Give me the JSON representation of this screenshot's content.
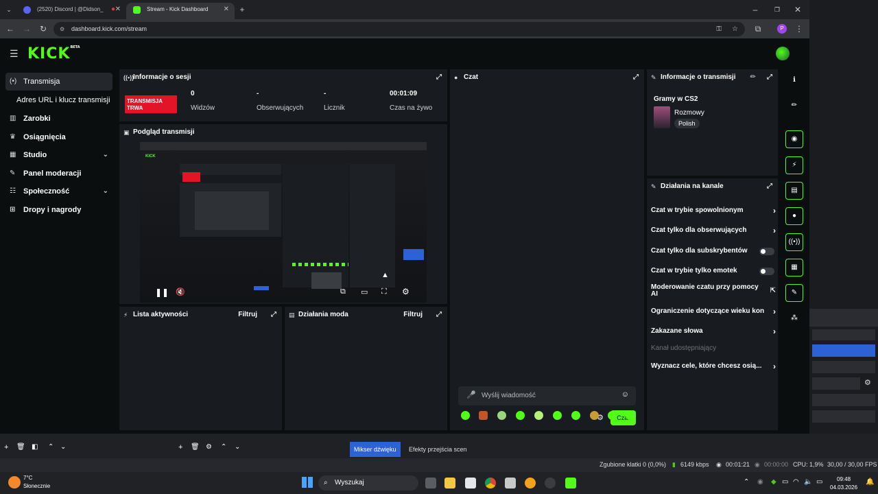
{
  "browser": {
    "tabs": [
      {
        "title": "(2520) Discord | @Didson_",
        "active": false
      },
      {
        "title": "Stream - Kick Dashboard",
        "active": true
      }
    ],
    "url": "dashboard.kick.com/stream",
    "profile_letter": "P"
  },
  "logo": {
    "text": "KICK",
    "badge": "BETA"
  },
  "sidebar": {
    "items": [
      {
        "label": "Transmisja",
        "active": true
      },
      {
        "label": "Zarobki"
      },
      {
        "label": "Osiągnięcia"
      },
      {
        "label": "Studio"
      },
      {
        "label": "Panel moderacji"
      },
      {
        "label": "Społeczność"
      },
      {
        "label": "Dropy i nagrody"
      }
    ],
    "subitem": "Adres URL i klucz transmisji"
  },
  "session": {
    "title": "Informacje o sesji",
    "live_badge": "TRANSMISJA TRWA",
    "stats": [
      {
        "value": "0",
        "label": "Widzów"
      },
      {
        "value": "-",
        "label": "Obserwujących"
      },
      {
        "value": "-",
        "label": "Licznik"
      },
      {
        "value": "00:01:09",
        "label": "Czas na żywo"
      }
    ]
  },
  "preview": {
    "title": "Podgląd transmisji"
  },
  "activity": {
    "title": "Lista aktywności",
    "filter": "Filtruj"
  },
  "modactions": {
    "title": "Działania moda",
    "filter": "Filtruj"
  },
  "chat": {
    "title": "Czat",
    "placeholder": "Wyślij wiadomość",
    "send": "Czat"
  },
  "streaminfo": {
    "title": "Informacje o transmisji",
    "stream_title": "Gramy w CS2",
    "category": "Rozmowy",
    "language": "Polish"
  },
  "channel": {
    "title": "Działania na kanale",
    "rows": [
      {
        "label": "Czat w trybie spowolnionym",
        "kind": "arrow"
      },
      {
        "label": "Czat tylko dla obserwujących",
        "kind": "arrow"
      },
      {
        "label": "Czat tylko dla subskrybentów",
        "kind": "toggle"
      },
      {
        "label": "Czat w trybie tylko emotek",
        "kind": "toggle"
      },
      {
        "label": "Moderowanie czatu przy pomocy AI",
        "kind": "ext"
      },
      {
        "label": "Ograniczenie dotyczące wieku kon",
        "kind": "arrow"
      },
      {
        "label": "Zakazane słowa",
        "kind": "arrow"
      },
      {
        "label": "Kanał udostępniający",
        "kind": "none"
      },
      {
        "label": "Wyznacz cele, które chcesz osią...",
        "kind": "arrow"
      }
    ]
  },
  "obs": {
    "tabs": [
      {
        "label": "Mikser dźwięku",
        "active": true
      },
      {
        "label": "Efekty przejścia scen",
        "active": false
      }
    ]
  },
  "status": {
    "dropped": "Zgubione klatki 0 (0,0%)",
    "bitrate": "6149 kbps",
    "live": "00:01:21",
    "rec": "00:00:00",
    "cpu": "CPU: 1,9%",
    "fps": "30,00 / 30,00 FPS"
  },
  "taskbar": {
    "temp": "7°C",
    "weather": "Słonecznie",
    "search": "Wyszukaj",
    "time": "09:48",
    "date": "04.03.2026"
  },
  "colors": {
    "kick_green": "#53fc18",
    "live_red": "#e41428",
    "obs_active": "#2c62d6"
  }
}
